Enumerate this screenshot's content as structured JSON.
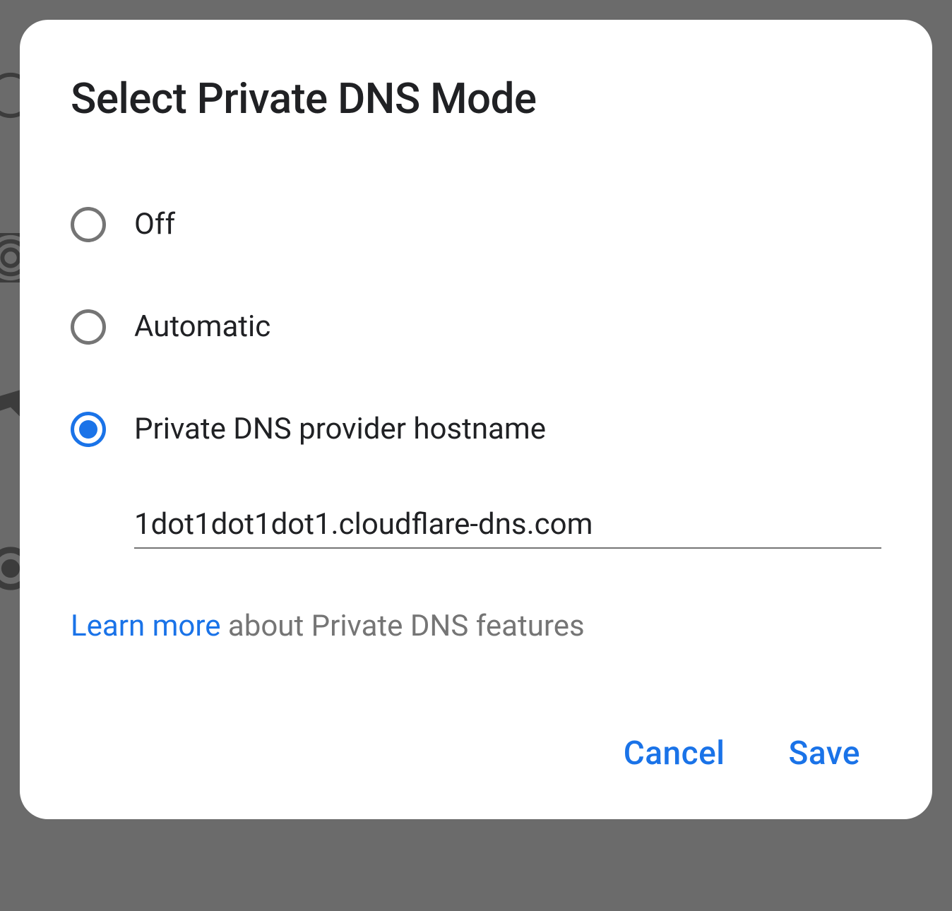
{
  "dialog": {
    "title": "Select Private DNS Mode",
    "options": [
      {
        "label": "Off",
        "selected": false
      },
      {
        "label": "Automatic",
        "selected": false
      },
      {
        "label": "Private DNS provider hostname",
        "selected": true
      }
    ],
    "hostname_value": "1dot1dot1dot1.cloudflare-dns.com",
    "footer": {
      "link_text": "Learn more",
      "suffix_text": " about Private DNS features"
    },
    "actions": {
      "cancel_label": "Cancel",
      "save_label": "Save"
    }
  },
  "colors": {
    "accent": "#1a73e8",
    "text_primary": "#202124",
    "text_secondary": "#757575"
  }
}
